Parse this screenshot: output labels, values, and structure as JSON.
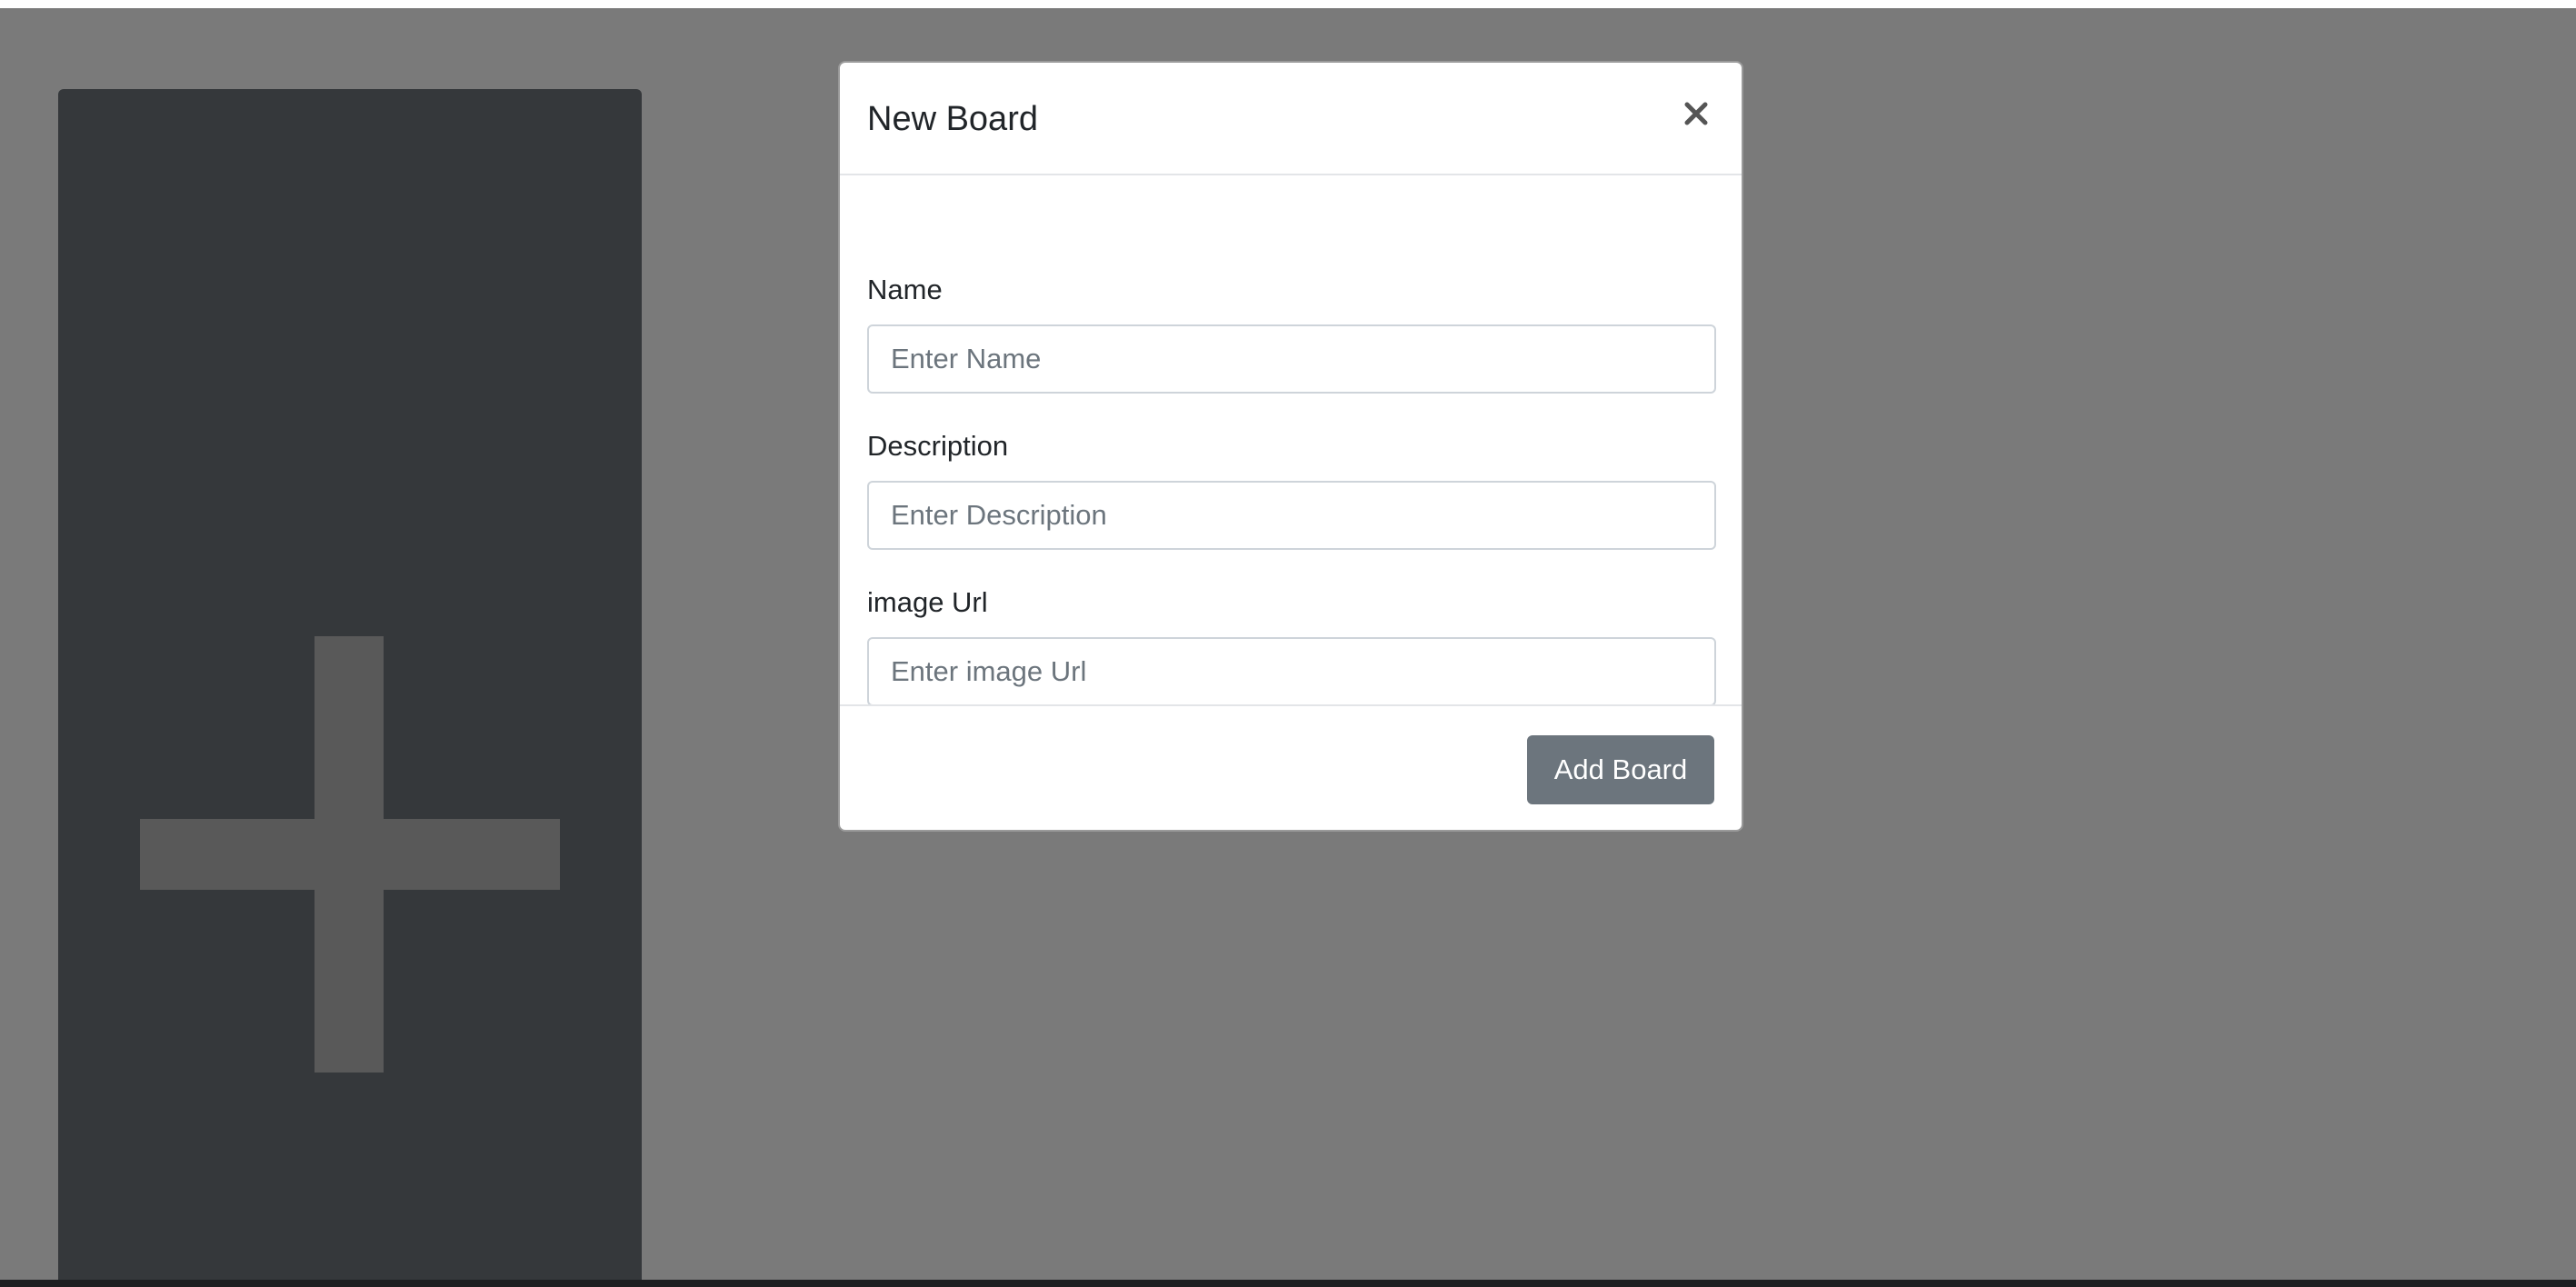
{
  "modal": {
    "title": "New Board",
    "close_icon": "close-icon",
    "fields": {
      "name": {
        "label": "Name",
        "placeholder": "Enter Name",
        "value": ""
      },
      "description": {
        "label": "Description",
        "placeholder": "Enter Description",
        "value": ""
      },
      "image_url": {
        "label": "image Url",
        "placeholder": "Enter image Url",
        "value": ""
      }
    },
    "submit_label": "Add Board"
  },
  "background": {
    "add_card_icon": "plus-icon"
  },
  "colors": {
    "backdrop": "#797775",
    "card": "#393c3f",
    "plus": "#5a5a5a",
    "button": "#6c757d"
  }
}
